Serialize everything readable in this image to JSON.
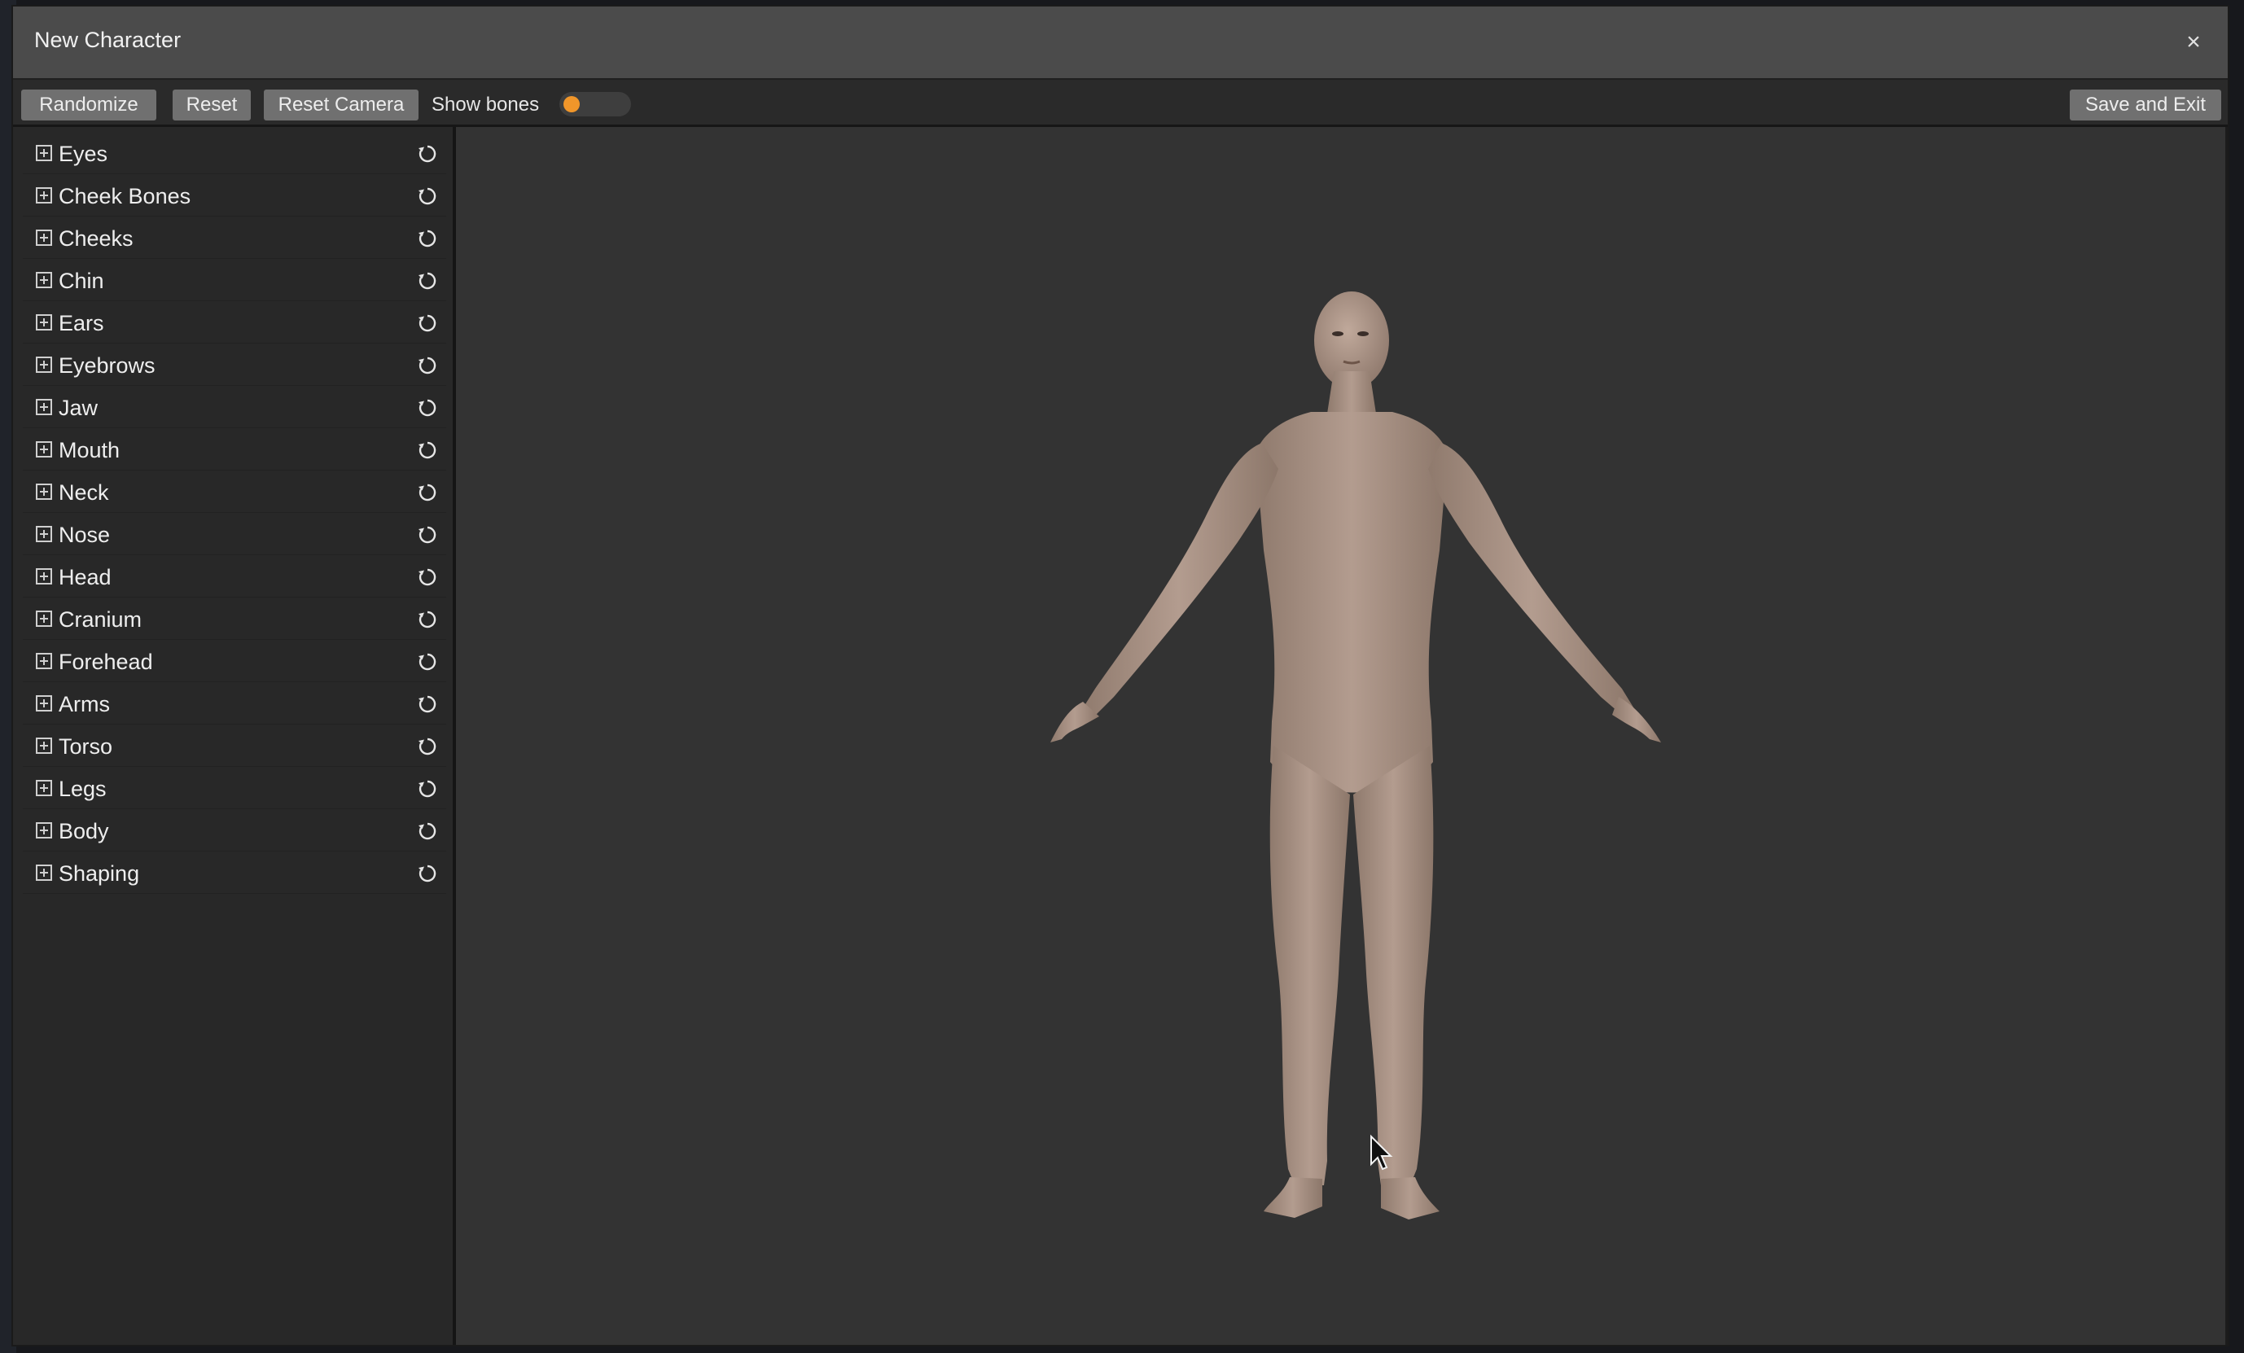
{
  "window": {
    "title": "New Character",
    "close_label": "×"
  },
  "toolbar": {
    "randomize_label": "Randomize",
    "reset_label": "Reset",
    "reset_camera_label": "Reset Camera",
    "show_bones_label": "Show bones",
    "show_bones_on": false,
    "save_exit_label": "Save and Exit"
  },
  "sidebar": {
    "items": [
      {
        "label": "Eyes"
      },
      {
        "label": "Cheek Bones"
      },
      {
        "label": "Cheeks"
      },
      {
        "label": "Chin"
      },
      {
        "label": "Ears"
      },
      {
        "label": "Eyebrows"
      },
      {
        "label": "Jaw"
      },
      {
        "label": "Mouth"
      },
      {
        "label": "Neck"
      },
      {
        "label": "Nose"
      },
      {
        "label": "Head"
      },
      {
        "label": "Cranium"
      },
      {
        "label": "Forehead"
      },
      {
        "label": "Arms"
      },
      {
        "label": "Torso"
      },
      {
        "label": "Legs"
      },
      {
        "label": "Body"
      },
      {
        "label": "Shaping"
      }
    ],
    "expand_icon": "plus-square-icon",
    "reset_icon": "reset-circle-icon"
  },
  "viewport": {
    "subject": "character-model",
    "cursor_icon": "mouse-pointer-icon"
  },
  "colors": {
    "accent": "#f0962a",
    "skin": "#a08a7d",
    "titlebar": "#4b4b4b",
    "button": "#707070",
    "panel": "#282828",
    "viewport": "#333333"
  }
}
